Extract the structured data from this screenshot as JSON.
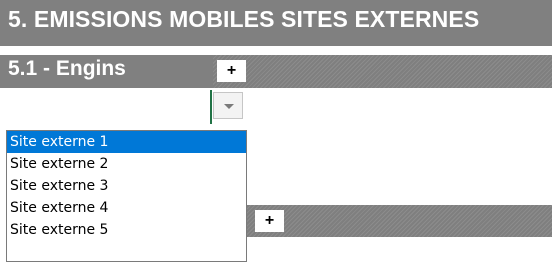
{
  "header": {
    "title": "5. EMISSIONS MOBILES SITES EXTERNES"
  },
  "section": {
    "title": "5.1 - Engins",
    "add_label": "+"
  },
  "section2": {
    "add_label": "+"
  },
  "dropdown": {
    "options": [
      {
        "label": "Site externe 1",
        "selected": true
      },
      {
        "label": "Site externe 2",
        "selected": false
      },
      {
        "label": "Site externe 3",
        "selected": false
      },
      {
        "label": "Site externe 4",
        "selected": false
      },
      {
        "label": "Site externe 5",
        "selected": false
      }
    ]
  },
  "colors": {
    "header_bg": "#808080",
    "selection": "#0078d7",
    "cell_border": "#217346"
  }
}
